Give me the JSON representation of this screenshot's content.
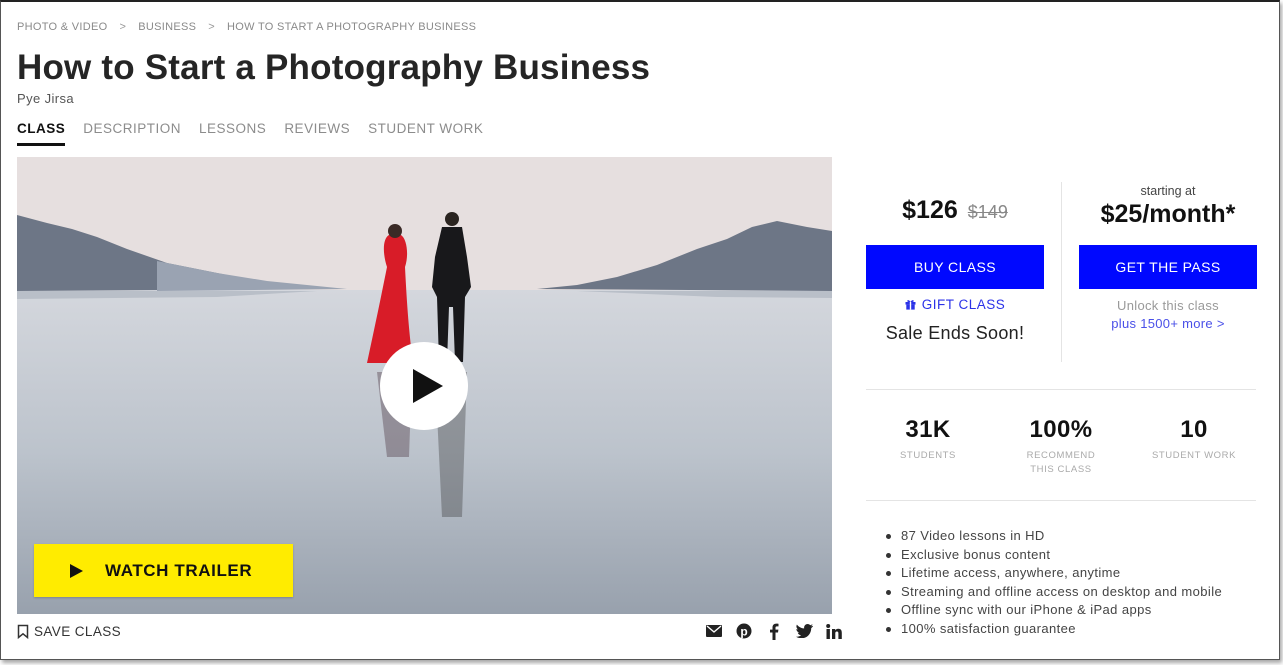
{
  "breadcrumb": [
    "PHOTO & VIDEO",
    "BUSINESS",
    "HOW TO START A PHOTOGRAPHY BUSINESS"
  ],
  "breadcrumb_sep": ">",
  "title": "How to Start a Photography Business",
  "author": "Pye Jirsa",
  "tabs": [
    "CLASS",
    "DESCRIPTION",
    "LESSONS",
    "REVIEWS",
    "STUDENT WORK"
  ],
  "video": {
    "trailer_label": "WATCH TRAILER"
  },
  "save_label": "SAVE CLASS",
  "share_icons": [
    "email-icon",
    "pinterest-icon",
    "facebook-icon",
    "twitter-icon",
    "linkedin-icon"
  ],
  "pricing": {
    "price": "$126",
    "old_price": "$149",
    "buy_label": "BUY CLASS",
    "gift_label": "GIFT CLASS",
    "sale_text": "Sale Ends Soon!",
    "starting_at": "starting at",
    "pass_price": "$25/month*",
    "pass_label": "GET THE PASS",
    "unlock_text": "Unlock this class",
    "plus_more": "plus 1500+ more >"
  },
  "stats": [
    {
      "value": "31K",
      "label_lines": [
        "STUDENTS"
      ]
    },
    {
      "value": "100%",
      "label_lines": [
        "RECOMMEND",
        "THIS CLASS"
      ]
    },
    {
      "value": "10",
      "label_lines": [
        "STUDENT WORK"
      ]
    }
  ],
  "features": [
    "87 Video lessons in HD",
    "Exclusive bonus content",
    "Lifetime access, anywhere, anytime",
    "Streaming and offline access on desktop and mobile",
    "Offline sync with our iPhone & iPad apps",
    "100% satisfaction guarantee"
  ],
  "colors": {
    "accent_blue": "#0008ff",
    "trailer_yellow": "#ffec00",
    "link_blue": "#2b32e8"
  }
}
